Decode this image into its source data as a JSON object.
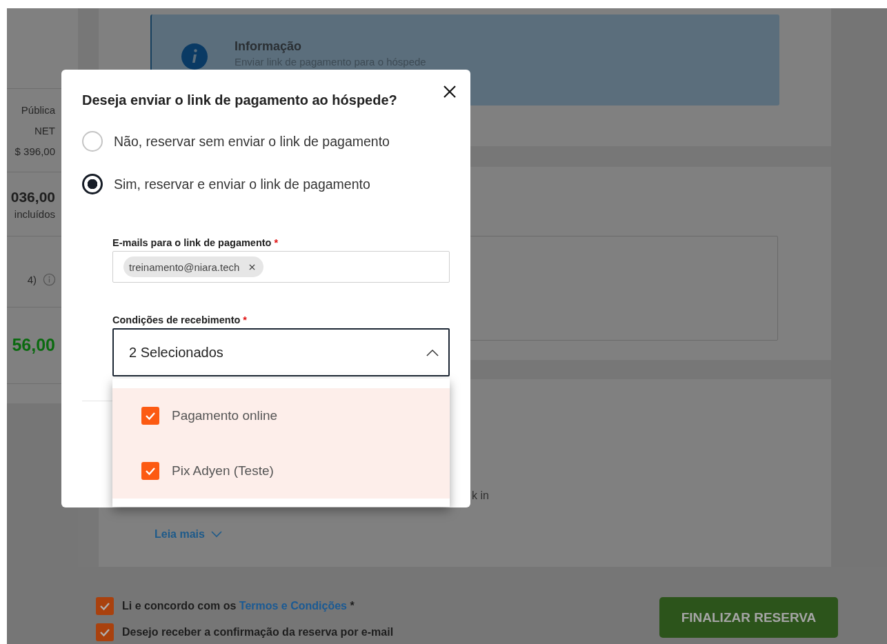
{
  "background": {
    "summary": [
      [
        {
          "kind": "text",
          "text": "Pública"
        },
        {
          "kind": "text",
          "text": "NET"
        },
        {
          "kind": "text",
          "text": "$ 396,00"
        }
      ],
      [
        {
          "kind": "amount",
          "text": "036,00"
        },
        {
          "kind": "text",
          "text": "incluídos"
        }
      ],
      [
        {
          "kind": "info",
          "text": "4)"
        }
      ],
      [
        {
          "kind": "total",
          "text": "56,00"
        }
      ]
    ],
    "info": {
      "title": "Informação",
      "text": "Enviar link de pagamento para o hóspede"
    },
    "fragment": "k in",
    "read_more": "Leia mais",
    "agreements": [
      {
        "text": "Li e concordo com os ",
        "link": "Termos e Condições",
        "suffix": " *",
        "checked": true
      },
      {
        "text": "Desejo receber a confirmação da reserva por e-mail",
        "checked": true
      }
    ],
    "finish_button": "FINALIZAR RESERVA"
  },
  "dialog": {
    "title": "Deseja enviar o link de pagamento ao hóspede?",
    "options": [
      {
        "label": "Não, reservar sem enviar o link de pagamento",
        "selected": false
      },
      {
        "label": "Sim, reservar e enviar o link de pagamento",
        "selected": true
      }
    ],
    "emails": {
      "label": "E-mails para o link de pagamento",
      "required_mark": "*",
      "chips": [
        "treinamento@niara.tech"
      ]
    },
    "conditions": {
      "label": "Condições de recebimento",
      "required_mark": "*",
      "value": "2 Selecionados",
      "expanded": true,
      "options": [
        {
          "label": "Pagamento online",
          "checked": true
        },
        {
          "label": "Pix Adyen (Teste)",
          "checked": true
        }
      ]
    }
  }
}
